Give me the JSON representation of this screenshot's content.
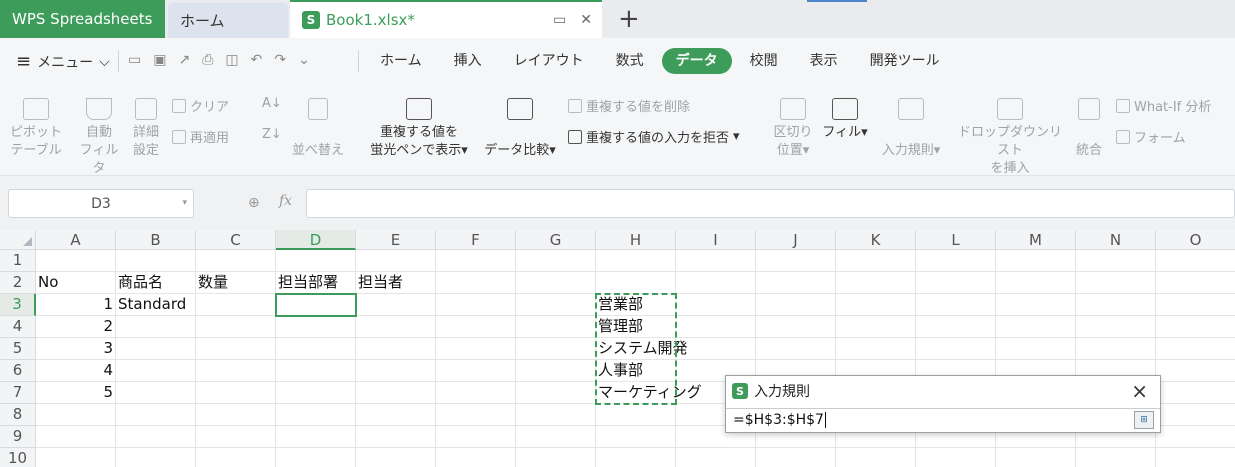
{
  "tabs": {
    "app": "WPS Spreadsheets",
    "home": "ホーム",
    "file": "Book1.xlsx*",
    "logo_letter": "S"
  },
  "menu": {
    "label": "メニュー",
    "ribbon_tabs": [
      "ホーム",
      "挿入",
      "レイアウト",
      "数式",
      "データ",
      "校閲",
      "表示",
      "開発ツール"
    ],
    "active_tab": "データ"
  },
  "ribbon": {
    "pivot": [
      "ピボット",
      "テーブル"
    ],
    "autofilter": [
      "自動",
      "フィルタ"
    ],
    "advanced": [
      "詳細",
      "設定"
    ],
    "clear": "クリア",
    "reapply": "再適用",
    "sort": "並べ替え",
    "highlight_dup": [
      "重複する値を",
      "蛍光ペンで表示"
    ],
    "compare": "データ比較",
    "remove_dup": "重複する値を削除",
    "reject_dup": "重複する値の入力を拒否",
    "text_to_columns": [
      "区切り",
      "位置"
    ],
    "fill": "フィル",
    "validation": "入力規則",
    "dropdown": [
      "ドロップダウンリスト",
      "を挿入"
    ],
    "consolidate": "統合",
    "whatif": "What-If 分析",
    "form": "フォーム"
  },
  "formula_bar": {
    "name_box": "D3",
    "fx": "fx",
    "formula": ""
  },
  "grid": {
    "columns": [
      "A",
      "B",
      "C",
      "D",
      "E",
      "F",
      "G",
      "H",
      "I",
      "J",
      "K",
      "L",
      "M",
      "N",
      "O"
    ],
    "rows": [
      "1",
      "2",
      "3",
      "4",
      "5",
      "6",
      "7",
      "8",
      "9",
      "10"
    ],
    "selected_col": "D",
    "selected_row": "3",
    "cells": [
      {
        "ref": "A2",
        "value": "No"
      },
      {
        "ref": "B2",
        "value": "商品名"
      },
      {
        "ref": "C2",
        "value": "数量"
      },
      {
        "ref": "D2",
        "value": "担当部署"
      },
      {
        "ref": "E2",
        "value": "担当者"
      },
      {
        "ref": "A3",
        "value": "1"
      },
      {
        "ref": "B3",
        "value": "Standard"
      },
      {
        "ref": "A4",
        "value": "2"
      },
      {
        "ref": "A5",
        "value": "3"
      },
      {
        "ref": "A6",
        "value": "4"
      },
      {
        "ref": "A7",
        "value": "5"
      },
      {
        "ref": "H3",
        "value": "営業部"
      },
      {
        "ref": "H4",
        "value": "管理部"
      },
      {
        "ref": "H5",
        "value": "システム開発"
      },
      {
        "ref": "H6",
        "value": "人事部"
      },
      {
        "ref": "H7",
        "value": "マーケティング"
      }
    ]
  },
  "dialog": {
    "title": "入力規則",
    "value": "=$H$3:$H$7",
    "close": "×"
  },
  "colors": {
    "accent": "#3d9c5a"
  }
}
